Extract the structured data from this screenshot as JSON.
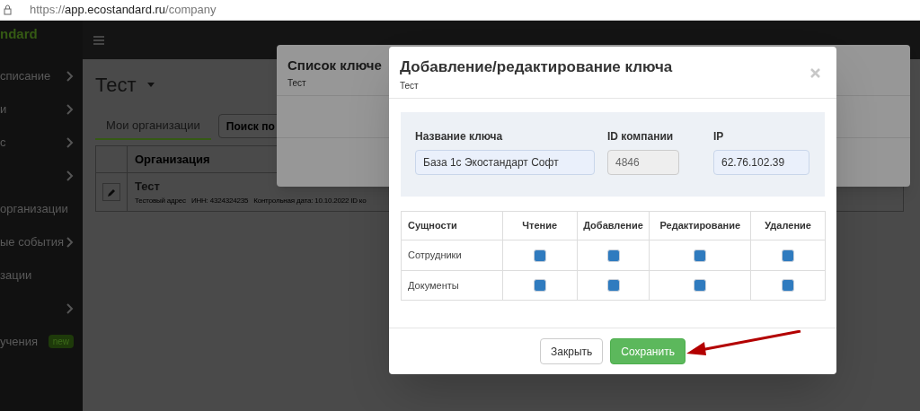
{
  "address_bar": {
    "scheme": "https://",
    "host": "app.ecostandard.ru",
    "path": "/company"
  },
  "logo": {
    "text": "ndard"
  },
  "sidebar": {
    "items": [
      {
        "label": "списание",
        "has_submenu": true
      },
      {
        "label": "и",
        "has_submenu": true
      },
      {
        "label": "с",
        "has_submenu": true
      },
      {
        "has_submenu": true
      },
      {
        "label": "организации",
        "has_submenu": false
      },
      {
        "label": "ые события",
        "has_submenu": true
      },
      {
        "label": "зации",
        "has_submenu": false
      },
      {
        "has_submenu": true
      },
      {
        "label": "учения",
        "has_submenu": false,
        "badge": "new"
      }
    ]
  },
  "page": {
    "title": "Тест",
    "tabs": [
      {
        "label": "Мои организации",
        "selected": true
      }
    ],
    "search": {
      "placeholder": "Поиск по"
    },
    "table": {
      "columns": [
        "Организация"
      ],
      "rows": [
        {
          "name": "Тест",
          "details": "Тестовый адрес   ИНН: 4324324235   Контрольная дата: 10.10.2022 ID ко"
        }
      ]
    }
  },
  "back_modal": {
    "title": "Список ключе",
    "subtitle": "Тест"
  },
  "modal": {
    "title": "Добавление/редактирование ключа",
    "subtitle": "Тест",
    "fields": [
      {
        "label": "Название ключа",
        "value": "База 1с Экостандарт Софт",
        "disabled": false
      },
      {
        "label": "ID компании",
        "value": "4846",
        "disabled": true
      },
      {
        "label": "IP",
        "value": "62.76.102.39",
        "disabled": false
      }
    ],
    "permissions": {
      "columns": [
        "Сущности",
        "Чтение",
        "Добавление",
        "Редактирование",
        "Удаление"
      ],
      "rows": [
        {
          "entity": "Сотрудники",
          "checks": [
            true,
            true,
            true,
            true
          ]
        },
        {
          "entity": "Документы",
          "checks": [
            true,
            true,
            true,
            true
          ]
        }
      ]
    },
    "buttons": [
      {
        "label": "Закрыть",
        "kind": "default"
      },
      {
        "label": "Сохранить",
        "kind": "primary"
      }
    ]
  }
}
